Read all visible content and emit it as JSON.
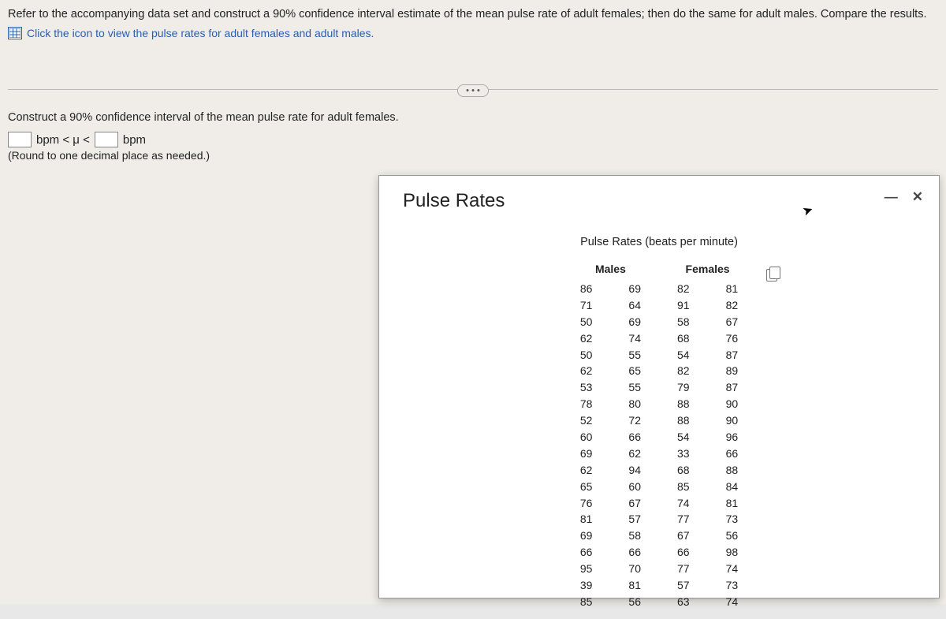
{
  "question": {
    "main_text": "Refer to the accompanying data set and construct a 90% confidence interval estimate of the mean pulse rate of adult females; then do the same for adult males. Compare the results.",
    "link_text": "Click the icon to view the pulse rates for adult females and adult males.",
    "dots": "• • •",
    "sub_text": "Construct a 90% confidence interval of the mean pulse rate for adult females.",
    "bpm1": "bpm < μ <",
    "bpm2": "bpm",
    "round_note": "(Round to one decimal place as needed.)"
  },
  "popup": {
    "title": "Pulse Rates",
    "subtitle": "Pulse Rates (beats per minute)",
    "headers": {
      "males": "Males",
      "females": "Females"
    },
    "minimize": "—",
    "close": "✕"
  },
  "data": {
    "males_c1": [
      86,
      71,
      50,
      62,
      50,
      62,
      53,
      78,
      52,
      60,
      69,
      62,
      65,
      76,
      81,
      69,
      66,
      95,
      39,
      85
    ],
    "males_c2": [
      69,
      64,
      69,
      74,
      55,
      65,
      55,
      80,
      72,
      66,
      62,
      94,
      60,
      67,
      57,
      58,
      66,
      70,
      81,
      56
    ],
    "females_c1": [
      82,
      91,
      58,
      68,
      54,
      82,
      79,
      88,
      88,
      54,
      33,
      68,
      85,
      74,
      77,
      67,
      66,
      77,
      57,
      63
    ],
    "females_c2": [
      81,
      82,
      67,
      76,
      87,
      89,
      87,
      90,
      90,
      96,
      66,
      88,
      84,
      81,
      73,
      56,
      98,
      74,
      73,
      74
    ]
  },
  "chart_data": {
    "type": "table",
    "title": "Pulse Rates (beats per minute)",
    "series": [
      {
        "name": "Males",
        "values": [
          86,
          71,
          50,
          62,
          50,
          62,
          53,
          78,
          52,
          60,
          69,
          62,
          65,
          76,
          81,
          69,
          66,
          95,
          39,
          85,
          69,
          64,
          69,
          74,
          55,
          65,
          55,
          80,
          72,
          66,
          62,
          94,
          60,
          67,
          57,
          58,
          66,
          70,
          81,
          56
        ]
      },
      {
        "name": "Females",
        "values": [
          82,
          91,
          58,
          68,
          54,
          82,
          79,
          88,
          88,
          54,
          33,
          68,
          85,
          74,
          77,
          67,
          66,
          77,
          57,
          63,
          81,
          82,
          67,
          76,
          87,
          89,
          87,
          90,
          90,
          96,
          66,
          88,
          84,
          81,
          73,
          56,
          98,
          74,
          73,
          74
        ]
      }
    ]
  }
}
